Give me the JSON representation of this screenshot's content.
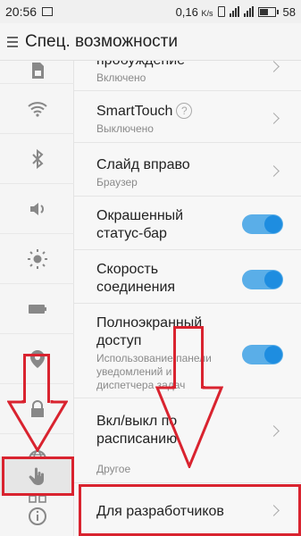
{
  "status_bar": {
    "time": "20:56",
    "data_rate": "0,16",
    "data_rate_unit": "K/s",
    "battery": "58"
  },
  "header": {
    "title": "Спец. возможности"
  },
  "sidebar": {
    "items": [
      {
        "icon": "sim-card-icon"
      },
      {
        "icon": "wifi-icon"
      },
      {
        "icon": "bluetooth-icon"
      },
      {
        "icon": "sound-icon"
      },
      {
        "icon": "brightness-icon"
      },
      {
        "icon": "battery-icon"
      },
      {
        "icon": "location-icon"
      },
      {
        "icon": "lock-icon"
      },
      {
        "icon": "globe-icon"
      },
      {
        "icon": "apps-grid-icon"
      },
      {
        "icon": "hand-icon"
      },
      {
        "icon": "info-icon"
      }
    ]
  },
  "settings": {
    "wake": {
      "title": "пробуждение",
      "subtitle": "Включено"
    },
    "smarttouch": {
      "title": "SmartTouch",
      "subtitle": "Выключено"
    },
    "swipe_right": {
      "title": "Слайд вправо",
      "subtitle": "Браузер"
    },
    "colored_statusbar": {
      "title_line1": "Окрашенный",
      "title_line2": "статус-бар",
      "enabled": true
    },
    "connection_speed": {
      "title_line1": "Скорость",
      "title_line2": "соединения",
      "enabled": true
    },
    "fullscreen": {
      "title_line1": "Полноэкранный",
      "title_line2": "доступ",
      "sub_line1": "Использование панели",
      "sub_line2": "уведомлений и",
      "sub_line3": "диспетчера задач",
      "enabled": true
    },
    "schedule": {
      "title_line1": "Вкл/выкл по",
      "title_line2": "расписанию"
    },
    "other_section": "Другое",
    "developers": {
      "title": "Для разработчиков"
    }
  },
  "annotation": {
    "color": "#d9232f"
  }
}
